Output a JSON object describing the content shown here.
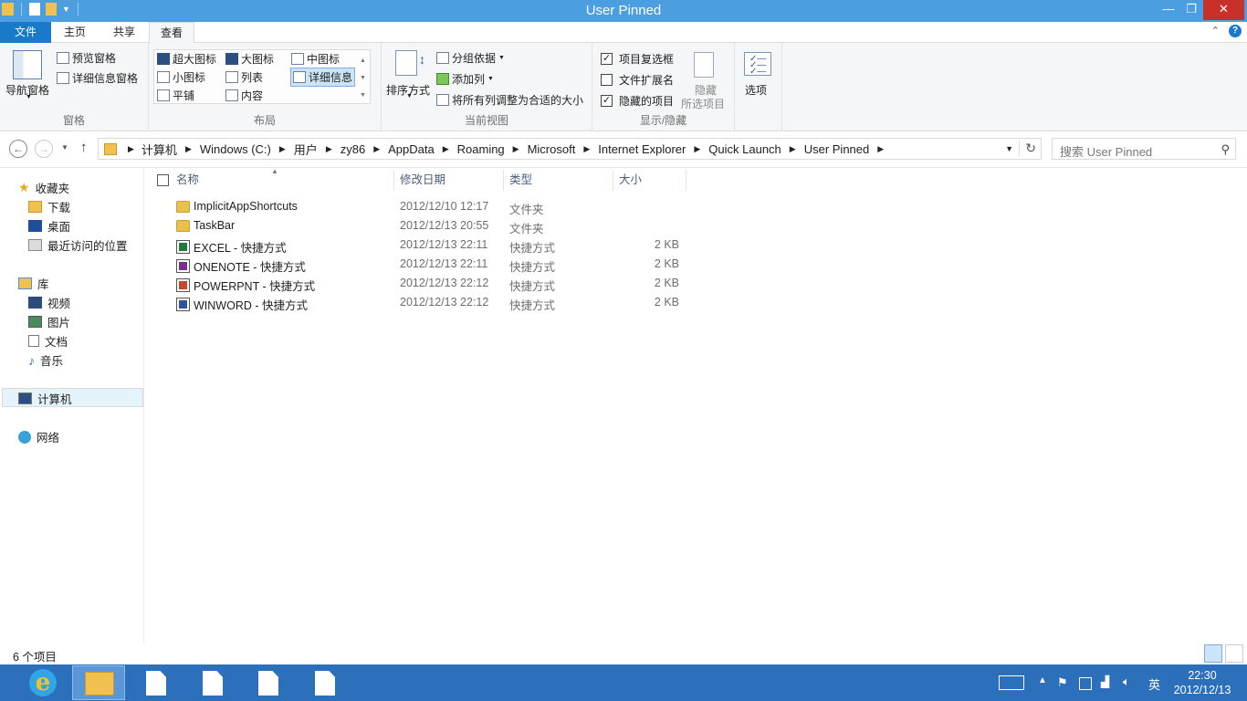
{
  "window": {
    "title": "User Pinned"
  },
  "window_controls": {
    "minimize": "—",
    "maximize": "❐",
    "close": "✕"
  },
  "ribbon_tabs": [
    "文件",
    "主页",
    "共享",
    "查看"
  ],
  "ribbon": {
    "panes": {
      "nav_pane": "导航窗格",
      "preview_pane": "预览窗格",
      "details_pane": "详细信息窗格",
      "label": "窗格"
    },
    "layout": {
      "items": [
        "超大图标",
        "大图标",
        "中图标",
        "小图标",
        "列表",
        "详细信息",
        "平铺",
        "内容"
      ],
      "selected": "详细信息",
      "label": "布局"
    },
    "current_view": {
      "sort_by": "排序方式",
      "group_by": "分组依据",
      "add_columns": "添加列",
      "size_all_columns": "将所有列调整为合适的大小",
      "label": "当前视图"
    },
    "show_hide": {
      "item_checkboxes": {
        "label": "项目复选框",
        "checked": true
      },
      "file_name_extensions": {
        "label": "文件扩展名",
        "checked": false
      },
      "hidden_items": {
        "label": "隐藏的项目",
        "checked": true
      },
      "hide_selected_line1": "隐藏",
      "hide_selected_line2": "所选项目",
      "label": "显示/隐藏"
    },
    "options": "选项"
  },
  "address": {
    "breadcrumbs": [
      "计算机",
      "Windows (C:)",
      "用户",
      "zy86",
      "AppData",
      "Roaming",
      "Microsoft",
      "Internet Explorer",
      "Quick Launch",
      "User Pinned"
    ],
    "search_placeholder": "搜索 User Pinned"
  },
  "nav_pane": {
    "favorites": {
      "label": "收藏夹",
      "items": [
        "下载",
        "桌面",
        "最近访问的位置"
      ]
    },
    "libraries": {
      "label": "库",
      "items": [
        "视频",
        "图片",
        "文档",
        "音乐"
      ]
    },
    "computer": "计算机",
    "network": "网络"
  },
  "columns": [
    "名称",
    "修改日期",
    "类型",
    "大小"
  ],
  "files": [
    {
      "name": "ImplicitAppShortcuts",
      "date": "2012/12/10 12:17",
      "type": "文件夹",
      "size": "",
      "icon": "folder-icon"
    },
    {
      "name": "TaskBar",
      "date": "2012/12/13 20:55",
      "type": "文件夹",
      "size": "",
      "icon": "folder-icon"
    },
    {
      "name": "EXCEL - 快捷方式",
      "date": "2012/12/13 22:11",
      "type": "快捷方式",
      "size": "2 KB",
      "icon": "excel-shortcut-icon",
      "color": "#1d7a3c"
    },
    {
      "name": "ONENOTE - 快捷方式",
      "date": "2012/12/13 22:11",
      "type": "快捷方式",
      "size": "2 KB",
      "icon": "onenote-shortcut-icon",
      "color": "#7a2e8e"
    },
    {
      "name": "POWERPNT - 快捷方式",
      "date": "2012/12/13 22:12",
      "type": "快捷方式",
      "size": "2 KB",
      "icon": "powerpoint-shortcut-icon",
      "color": "#c8462a"
    },
    {
      "name": "WINWORD - 快捷方式",
      "date": "2012/12/13 22:12",
      "type": "快捷方式",
      "size": "2 KB",
      "icon": "word-shortcut-icon",
      "color": "#2b579a"
    }
  ],
  "status": {
    "item_count": "6 个项目"
  },
  "taskbar": {
    "ime": "英",
    "time": "22:30",
    "date": "2012/12/13"
  },
  "colors": {
    "title_bar": "#4b9fe0",
    "file_tab": "#1979ca",
    "taskbar": "#2c6fba",
    "close": "#c7312a"
  }
}
